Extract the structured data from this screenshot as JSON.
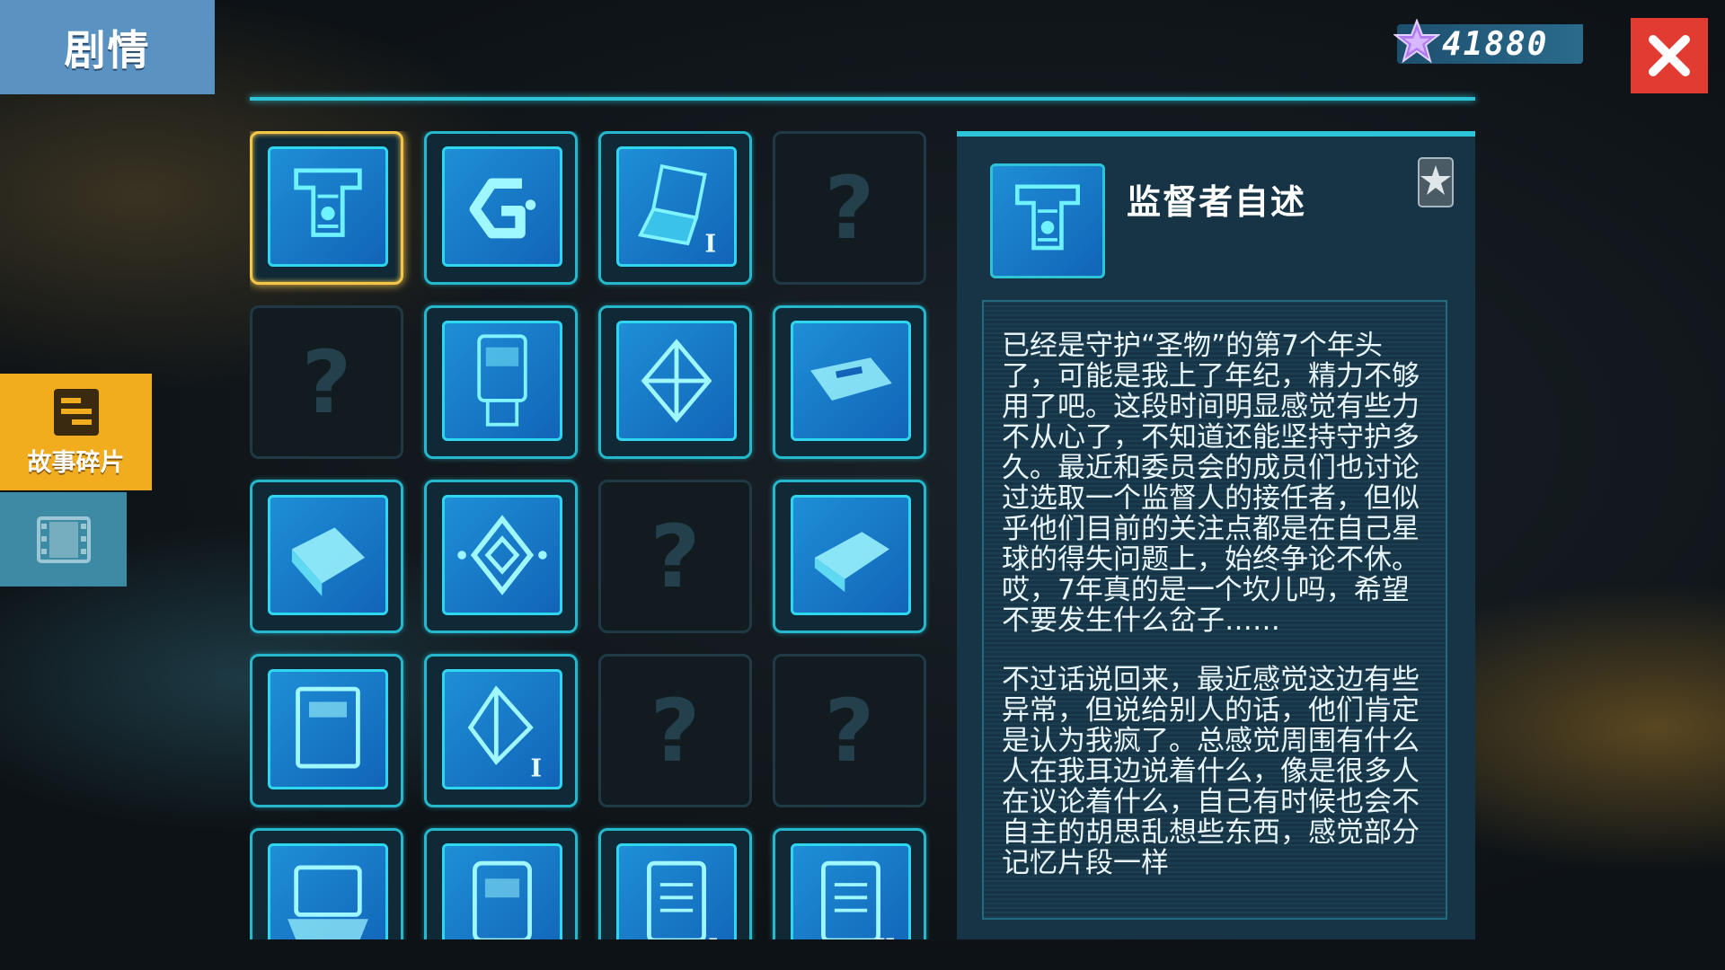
{
  "header": {
    "title": "剧情"
  },
  "currency": {
    "amount": "41880",
    "icon": "purple-star-gem-icon"
  },
  "close": {
    "icon": "close-icon"
  },
  "side_tabs": [
    {
      "label": "故事碎片",
      "icon": "story-fragment-icon",
      "active": true
    },
    {
      "label": "",
      "icon": "film-strip-icon",
      "active": false
    }
  ],
  "grid": {
    "items": [
      {
        "icon": "circuit-board-icon",
        "unlocked": true,
        "selected": true
      },
      {
        "icon": "g-logo-icon",
        "unlocked": true
      },
      {
        "icon": "laptop-icon",
        "unlocked": true,
        "badge": "I"
      },
      {
        "icon": "question-mark-icon",
        "unlocked": false,
        "label": "?"
      },
      {
        "icon": "question-mark-icon",
        "unlocked": false,
        "label": "?"
      },
      {
        "icon": "handheld-device-icon",
        "unlocked": true
      },
      {
        "icon": "crystal-icon",
        "unlocked": true
      },
      {
        "icon": "usb-drive-icon",
        "unlocked": true
      },
      {
        "icon": "book-icon",
        "unlocked": true
      },
      {
        "icon": "diamond-emblem-icon",
        "unlocked": true
      },
      {
        "icon": "question-mark-icon",
        "unlocked": false,
        "label": "?"
      },
      {
        "icon": "book-icon",
        "unlocked": true
      },
      {
        "icon": "notebook-icon",
        "unlocked": true
      },
      {
        "icon": "crystal-icon",
        "unlocked": true,
        "badge": "I"
      },
      {
        "icon": "question-mark-icon",
        "unlocked": false,
        "label": "?"
      },
      {
        "icon": "question-mark-icon",
        "unlocked": false,
        "label": "?"
      },
      {
        "icon": "console-icon",
        "unlocked": true
      },
      {
        "icon": "robot-device-icon",
        "unlocked": true
      },
      {
        "icon": "document-icon",
        "unlocked": true,
        "badge": "I"
      },
      {
        "icon": "document-icon",
        "unlocked": true,
        "badge": "II"
      }
    ]
  },
  "detail": {
    "title": "监督者自述",
    "icon": "circuit-board-icon",
    "rank_icon": "silver-star-badge-icon",
    "paragraphs": [
      "已经是守护“圣物”的第7个年头了，可能是我上了年纪，精力不够用了吧。这段时间明显感觉有些力不从心了，不知道还能坚持守护多久。最近和委员会的成员们也讨论过选取一个监督人的接任者，但似乎他们目前的关注点都是在自己星球的得失问题上，始终争论不休。哎，7年真的是一个坎儿吗，希望不要发生什么岔子……",
      "不过话说回来，最近感觉这边有些异常，但说给别人的话，他们肯定是认为我疯了。总感觉周围有什么人在我耳边说着什么，像是很多人在议论着什么，自己有时候也会不自主的胡思乱想些东西，感觉部分记忆片段一样"
    ]
  }
}
